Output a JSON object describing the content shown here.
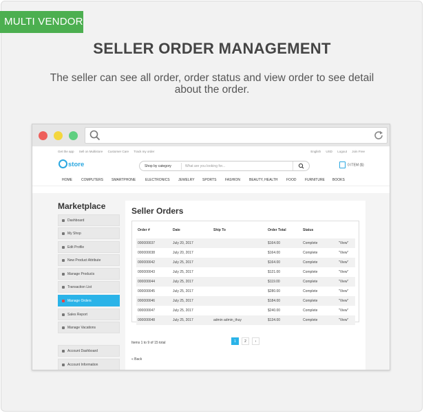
{
  "badge": "MULTI VENDOR",
  "title": "SELLER ORDER MANAGEMENT",
  "description": "The seller can see all order, order status and view order to see detail about the order.",
  "topbar": {
    "links": [
      "Get the app",
      "Sell on Multistore",
      "Customer Care",
      "Track my order"
    ],
    "right": [
      "English",
      "USD",
      "Logout",
      "Join Free"
    ]
  },
  "header": {
    "logo": "store",
    "category_select": "Shop by category",
    "search_placeholder": "What are you looking for...",
    "cart": "0 ITEM ($)"
  },
  "nav": [
    "HOME",
    "COMPUTERS",
    "SMARTPHONE",
    "ELECTRONICS",
    "JEWELRY",
    "SPORTS",
    "FASHION",
    "BEAUTY, HEALTH",
    "FOOD",
    "FURNITURE",
    "BOOKS"
  ],
  "sidebar": {
    "title": "Marketplace",
    "items": [
      "Dashboard",
      "My Shop",
      "Edit Profile",
      "New Product Attribute",
      "Manage Products",
      "Transaction List",
      "Manage Orders",
      "Sales Report",
      "Manage Vacations"
    ],
    "active_index": 6,
    "items2": [
      "Account Dashboard",
      "Account Information"
    ]
  },
  "panel": {
    "title": "Seller Orders",
    "columns": [
      "Order #",
      "Date",
      "Ship To",
      "Order Total",
      "Status"
    ],
    "rows": [
      {
        "order": "000000037",
        "date": "July 20, 2017",
        "ship_to": "",
        "total": "$164.00",
        "status": "Complete",
        "action": "View"
      },
      {
        "order": "000000038",
        "date": "July 20, 2017",
        "ship_to": "",
        "total": "$164.00",
        "status": "Complete",
        "action": "View"
      },
      {
        "order": "000000042",
        "date": "July 25, 2017",
        "ship_to": "",
        "total": "$164.00",
        "status": "Complete",
        "action": "View"
      },
      {
        "order": "000000043",
        "date": "July 25, 2017",
        "ship_to": "",
        "total": "$121.00",
        "status": "Complete",
        "action": "View"
      },
      {
        "order": "000000044",
        "date": "July 25, 2017",
        "ship_to": "",
        "total": "$119.00",
        "status": "Complete",
        "action": "View"
      },
      {
        "order": "000000045",
        "date": "July 25, 2017",
        "ship_to": "",
        "total": "$280.00",
        "status": "Complete",
        "action": "View"
      },
      {
        "order": "000000046",
        "date": "July 25, 2017",
        "ship_to": "",
        "total": "$184.00",
        "status": "Complete",
        "action": "View"
      },
      {
        "order": "000000047",
        "date": "July 25, 2017",
        "ship_to": "",
        "total": "$240.00",
        "status": "Complete",
        "action": "View"
      },
      {
        "order": "000000048",
        "date": "July 25, 2017",
        "ship_to": "admin admin_thuy",
        "total": "$134.00",
        "status": "Complete",
        "action": "View"
      }
    ],
    "items_count": "Items 1 to 9 of 15 total",
    "pages": [
      "1",
      "2",
      "›"
    ],
    "back": "« Back"
  },
  "colors": {
    "badge": "#4caf50",
    "accent": "#2ab3e8"
  }
}
